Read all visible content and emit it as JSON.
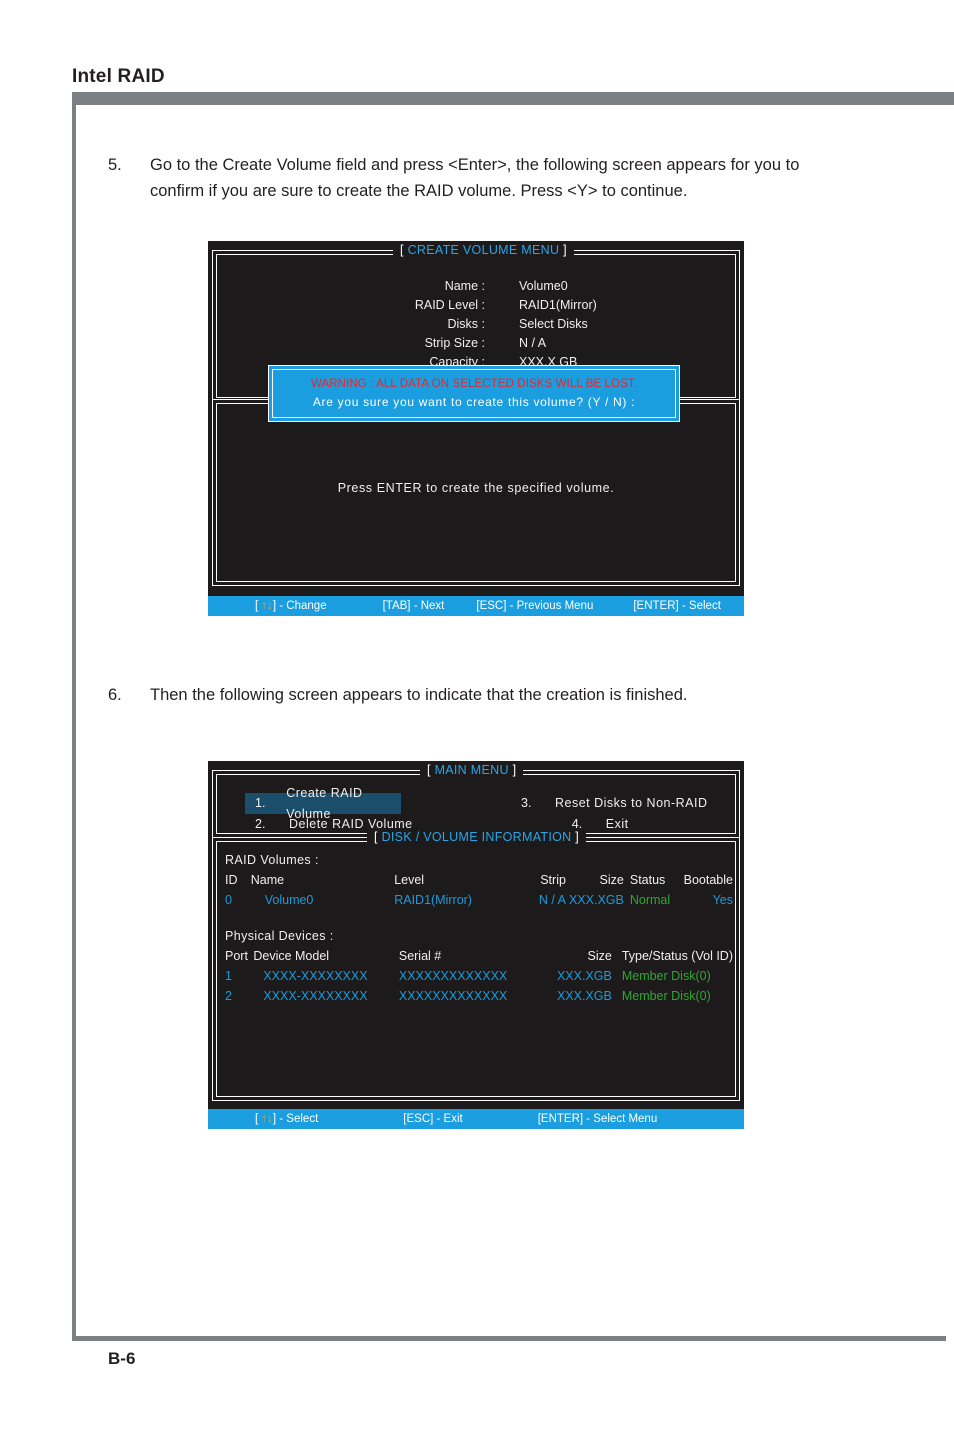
{
  "document": {
    "header_title": "Intel RAID",
    "page_number": "B-6"
  },
  "steps": [
    {
      "number": "5.",
      "text": "Go to the Create Volume field and press <Enter>, the following screen appears for you to confirm if you are sure to create the RAID volume. Press <Y> to continue."
    },
    {
      "number": "6.",
      "text": "Then the following screen appears to indicate that the creation is finished."
    }
  ],
  "create_volume_screen": {
    "panel_title": "CREATE VOLUME MENU",
    "bracket_open": "[",
    "bracket_close": "]",
    "fields": [
      {
        "label": "Name :",
        "value": "Volume0"
      },
      {
        "label": "RAID Level :",
        "value": "RAID1(Mirror)"
      },
      {
        "label": "Disks :",
        "value": "Select  Disks"
      },
      {
        "label": "Strip Size :",
        "value": "N / A"
      },
      {
        "label": "Capacity :",
        "value": "XXX.X  GB"
      }
    ],
    "warning_dialog": {
      "warning_text": "WARNING : ALL DATA ON SELECTED DISKS WILL BE LOST.",
      "confirm_text": "Are  you  sure  you  want  to  create  this  volume?  (Y / N)  :"
    },
    "help_text": "Press  ENTER  to  create  the  specified  volume.",
    "keybar": [
      {
        "prefix": "[ ",
        "arrows": "↑↓",
        "suffix": "] - Change"
      },
      {
        "prefix": "",
        "arrows": "",
        "suffix": "[TAB] - Next"
      },
      {
        "prefix": "",
        "arrows": "",
        "suffix": "[ESC] - Previous Menu"
      },
      {
        "prefix": "",
        "arrows": "",
        "suffix": "[ENTER] - Select"
      }
    ]
  },
  "main_menu_screen": {
    "panel_title": "MAIN  MENU",
    "info_panel_title": "DISK / VOLUME INFORMATION",
    "bracket_open": "[",
    "bracket_close": "]",
    "menu_items": [
      {
        "index": "1.",
        "label": "Create  RAID  Volume",
        "selected": true
      },
      {
        "index": "3.",
        "label": "Reset Disks to Non-RAID",
        "selected": false
      },
      {
        "index": "2.",
        "label": "Delete  RAID  Volume",
        "selected": false
      },
      {
        "index": "4.",
        "label": "Exit",
        "selected": false
      }
    ],
    "raid_volumes": {
      "section_label": "RAID  Volumes :",
      "columns": [
        "ID",
        "Name",
        "Level",
        "Strip",
        "Size",
        "Status",
        "Bootable"
      ],
      "rows": [
        {
          "id": "0",
          "name": "Volume0",
          "level": "RAID1(Mirror)",
          "strip": "N / A",
          "size": "XXX.XGB",
          "status": "Normal",
          "bootable": "Yes"
        }
      ]
    },
    "physical_devices": {
      "section_label": "Physical  Devices :",
      "columns": [
        "Port",
        "Device  Model",
        "Serial  #",
        "Size",
        "Type/Status (Vol  ID)"
      ],
      "rows": [
        {
          "port": "1",
          "model": "XXXX-XXXXXXXX",
          "serial": "XXXXXXXXXXXXX",
          "size": "XXX.XGB",
          "type_status": "Member  Disk(0)"
        },
        {
          "port": "2",
          "model": "XXXX-XXXXXXXX",
          "serial": "XXXXXXXXXXXXX",
          "size": "XXX.XGB",
          "type_status": "Member  Disk(0)"
        }
      ]
    },
    "keybar": [
      {
        "prefix": "[ ",
        "arrows": "↑↓",
        "suffix": "] - Select"
      },
      {
        "prefix": "",
        "arrows": "",
        "suffix": "[ESC] - Exit"
      },
      {
        "prefix": "",
        "arrows": "",
        "suffix": "[ENTER] - Select Menu"
      }
    ]
  },
  "colors": {
    "accent_blue": "#1a9ee0",
    "panel_bg": "#1d1a1b",
    "warning_red": "#e8252b",
    "status_green": "#2fa82f",
    "data_cyan": "#1b9bdc",
    "highlight": "#1b4e6b",
    "rule_gray": "#7b8084",
    "arrow_orange": "#f0a030"
  }
}
